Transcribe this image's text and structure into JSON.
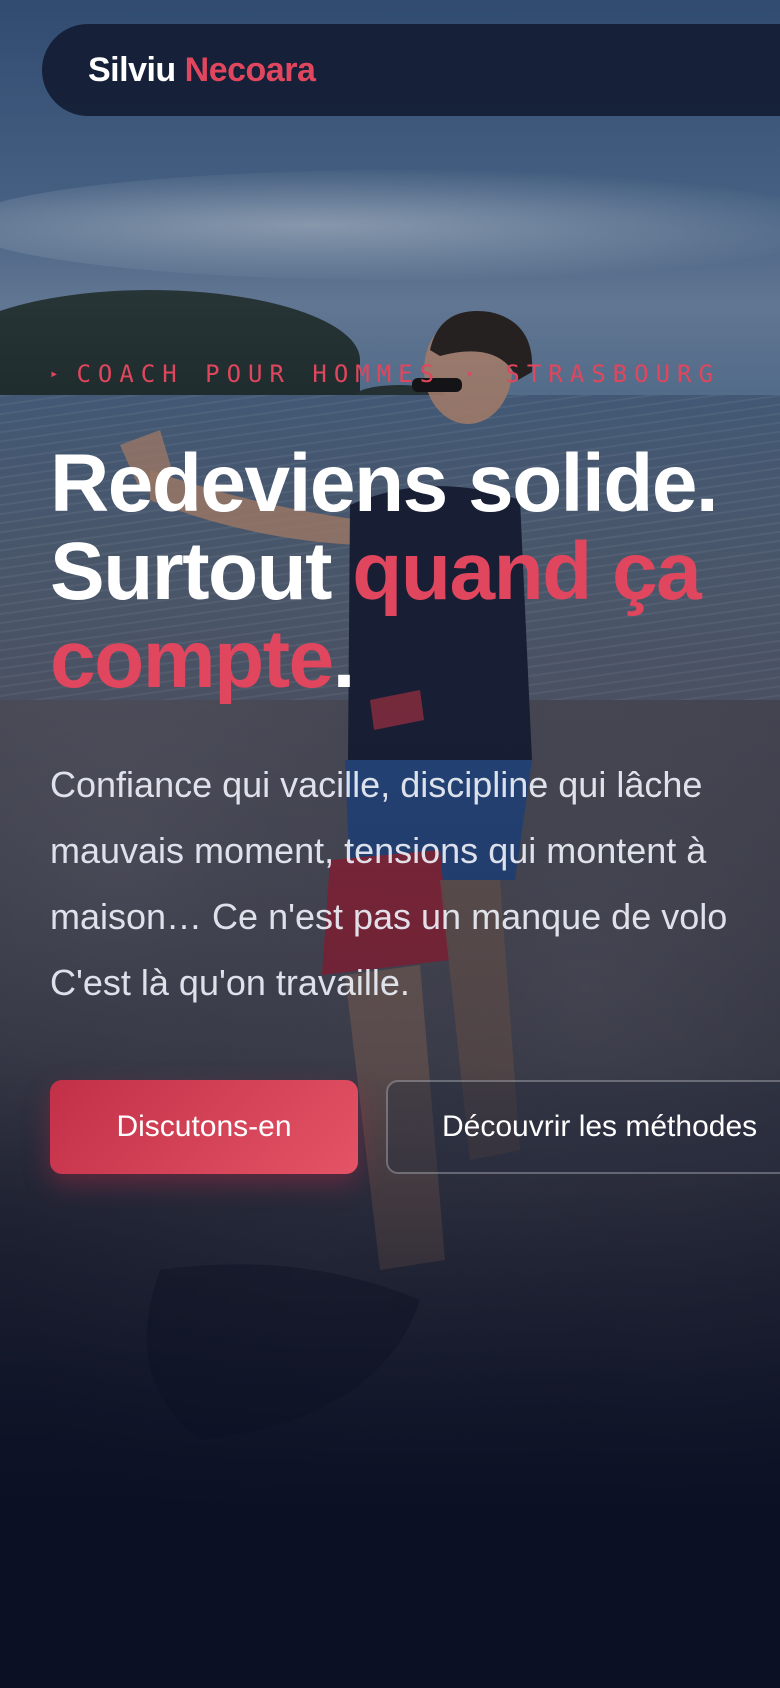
{
  "nav": {
    "brand_first": "Silviu",
    "brand_last": "Necoara"
  },
  "hero": {
    "eyebrow_arrow": "▸",
    "eyebrow": "COACH POUR HOMMES · STRASBOURG",
    "headline_line1": "Redeviens solide.",
    "headline_line2_plain": "Surtout ",
    "headline_line2_accent": "quand ça",
    "headline_line3_accent": "compte",
    "headline_line3_end": ".",
    "lead_lines": [
      "Confiance qui vacille, discipline qui lâche",
      "mauvais moment, tensions qui montent à",
      "maison… Ce n'est pas un manque de volo",
      "C'est là qu'on travaille."
    ],
    "cta_primary": "Discutons-en",
    "cta_secondary": "Découvrir les méthodes"
  },
  "colors": {
    "accent": "#e0465d",
    "page_background": "#0b1024",
    "nav_background": "#141c34"
  }
}
